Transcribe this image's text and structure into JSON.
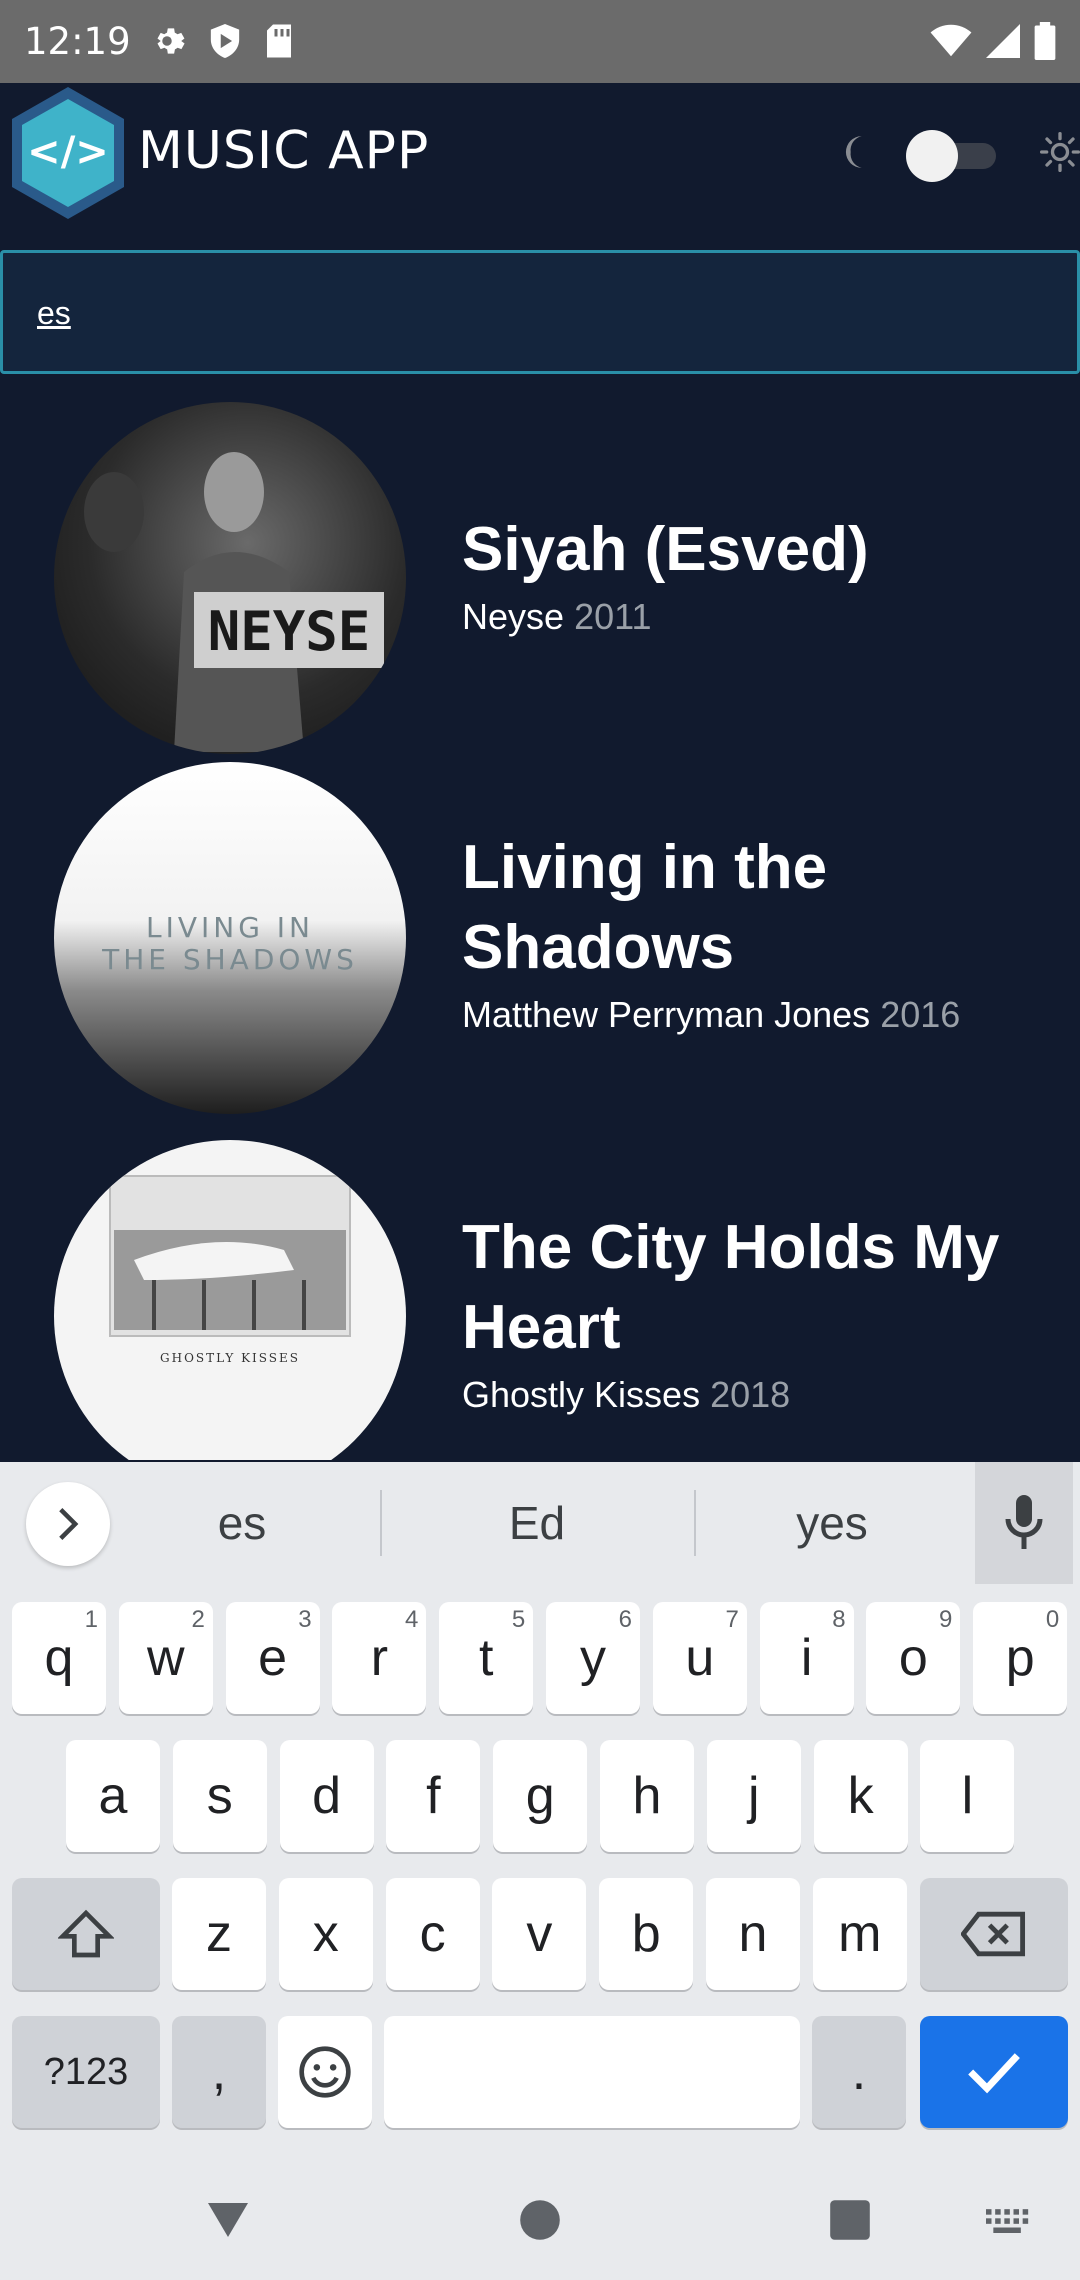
{
  "status_bar": {
    "time": "12:19"
  },
  "app_bar": {
    "title": "MUSIC APP",
    "logo_text": "</>"
  },
  "search": {
    "value": "es"
  },
  "results": [
    {
      "title": "Siyah (Esved)",
      "artist": "Neyse",
      "year": "2011",
      "cover_text": "NEYSE"
    },
    {
      "title": "Living in the Shadows",
      "artist": "Matthew Perryman Jones",
      "year": "2016",
      "cover_text": "LIVING IN THE SHADOWS"
    },
    {
      "title": "The City Holds My Heart",
      "artist": "Ghostly Kisses",
      "year": "2018",
      "cover_text": "GHOSTLY KISSES"
    }
  ],
  "keyboard": {
    "suggestions": [
      "es",
      "Ed",
      "yes"
    ],
    "row1": [
      {
        "k": "q",
        "h": "1"
      },
      {
        "k": "w",
        "h": "2"
      },
      {
        "k": "e",
        "h": "3"
      },
      {
        "k": "r",
        "h": "4"
      },
      {
        "k": "t",
        "h": "5"
      },
      {
        "k": "y",
        "h": "6"
      },
      {
        "k": "u",
        "h": "7"
      },
      {
        "k": "i",
        "h": "8"
      },
      {
        "k": "o",
        "h": "9"
      },
      {
        "k": "p",
        "h": "0"
      }
    ],
    "row2": [
      "a",
      "s",
      "d",
      "f",
      "g",
      "h",
      "j",
      "k",
      "l"
    ],
    "row3": [
      "z",
      "x",
      "c",
      "v",
      "b",
      "n",
      "m"
    ],
    "symbols_label": "?123",
    "comma": ",",
    "period": "."
  },
  "colors": {
    "background": "#111a2e",
    "accent": "#2a8fa8",
    "enter_key": "#1a73e8"
  }
}
